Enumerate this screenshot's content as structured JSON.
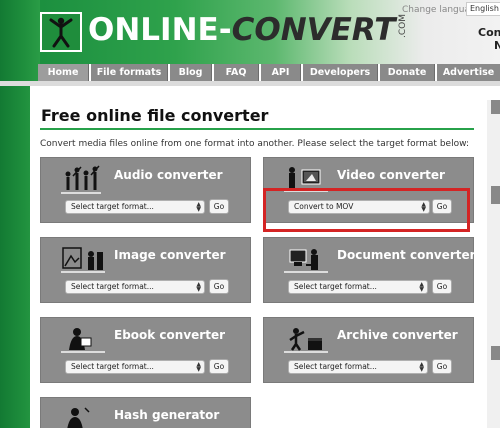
{
  "header": {
    "logo": {
      "online": "ONLINE",
      "dash": "-",
      "convert": "CONVERT",
      "com": ".COM"
    },
    "change_language_label": "Change language:",
    "language_value": "English",
    "right_text_line1": "Conve",
    "right_text_line2": "N"
  },
  "nav": {
    "items": [
      "Home",
      "File formats",
      "Blog",
      "FAQ",
      "API",
      "Developers",
      "Donate",
      "Advertise"
    ]
  },
  "main": {
    "title": "Free online file converter",
    "intro": "Convert media files online from one format into another. Please select the target format below:"
  },
  "converters": [
    {
      "title": "Audio converter",
      "select_value": "Select target format...",
      "go_label": "Go",
      "icon": "audio-people-icon"
    },
    {
      "title": "Video converter",
      "select_value": "Convert to MOV",
      "go_label": "Go",
      "icon": "video-camera-icon"
    },
    {
      "title": "Image converter",
      "select_value": "Select target format...",
      "go_label": "Go",
      "icon": "image-frame-icon"
    },
    {
      "title": "Document converter",
      "select_value": "Select target format...",
      "go_label": "Go",
      "icon": "document-computer-icon"
    },
    {
      "title": "Ebook converter",
      "select_value": "Select target format...",
      "go_label": "Go",
      "icon": "ebook-reader-icon"
    },
    {
      "title": "Archive converter",
      "select_value": "Select target format...",
      "go_label": "Go",
      "icon": "archive-box-icon"
    },
    {
      "title": "Hash generator",
      "icon": "hash-icon"
    }
  ],
  "colors": {
    "brand_green": "#1d8a3a",
    "card_gray": "#8c8c8c",
    "nav_gray": "#8a8a8a",
    "highlight_red": "#d42424"
  }
}
